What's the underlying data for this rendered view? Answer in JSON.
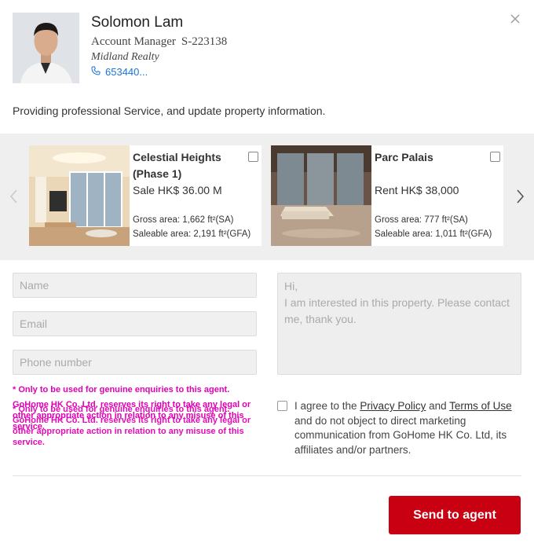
{
  "dialog": {
    "close_icon": "close-icon"
  },
  "agent": {
    "name": "Solomon Lam",
    "title": "Account Manager",
    "license": "S-223138",
    "company": "Midland Realty",
    "phone": "653440...",
    "phone_icon": "phone-icon"
  },
  "tagline": "Providing professional Service, and update property information.",
  "carousel": {
    "prev_icon": "chevron-left-icon",
    "next_icon": "chevron-right-icon",
    "cards": [
      {
        "title": "Celestial Heights (Phase 1)",
        "price": "Sale HK$ 36.00 M",
        "gross": "Gross area: 1,662 ft²(SA)",
        "saleable": "Saleable area: 2,191 ft²(GFA)",
        "checked": false
      },
      {
        "title": "Parc Palais",
        "price": "Rent HK$ 38,000",
        "gross": "Gross area: 777 ft²(SA)",
        "saleable": "Saleable area: 1,011 ft²(GFA)",
        "checked": false
      }
    ]
  },
  "form": {
    "name_placeholder": "Name",
    "email_placeholder": "Email",
    "phone_placeholder": "Phone number",
    "message_placeholder": "Hi,\nI am interested in this property. Please contact me, thank you.",
    "disclaimer_line1": "* Only to be used for genuine enquiries to this agent.",
    "disclaimer_line2": "GoHome HK Co. Ltd. reserves its right to take any legal or other appropriate action in relation to any misuse of this service.",
    "disclaimer_dup": "* Only to be used for genuine enquiries to this agent. GoHome HK Co. Ltd. reserves its right to take any legal or other appropriate action in relation to any misuse of this service.",
    "agree_prefix": "I agree to the ",
    "privacy_link": "Privacy Policy",
    "agree_and": " and ",
    "terms_link": "Terms of Use",
    "agree_suffix": " and do not object to direct marketing communication from GoHome HK Co. Ltd, its affiliates and/or partners.",
    "agree_checked": false,
    "send_label": "Send to agent"
  },
  "colors": {
    "accent": "#c80012",
    "link": "#1a73d9",
    "disclaimer": "#e000b4"
  }
}
